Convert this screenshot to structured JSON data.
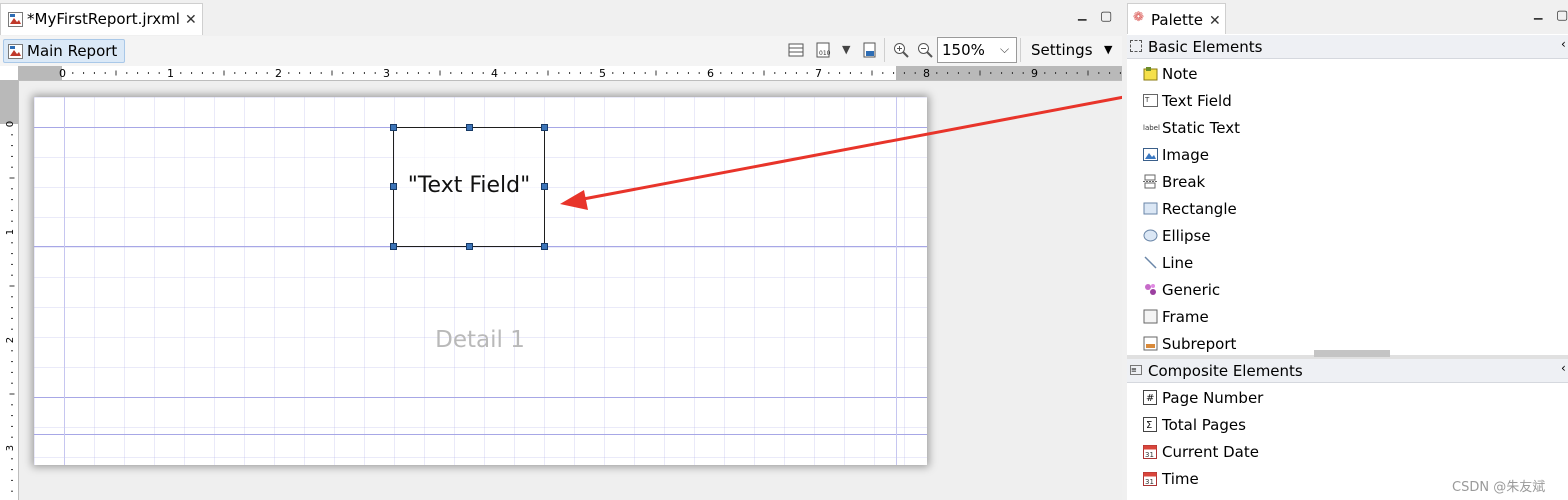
{
  "editor": {
    "tab_title": "*MyFirstReport.jrxml",
    "main_report_label": "Main Report",
    "zoom_value": "150%",
    "settings_label": "Settings",
    "ruler_numbers": [
      "0",
      "1",
      "2",
      "3",
      "4",
      "5",
      "6",
      "7",
      "8",
      "9"
    ],
    "vruler_numbers": [
      "0",
      "1",
      "2",
      "3"
    ],
    "text_field_text": "\"Text Field\"",
    "detail_band_label": "Detail 1"
  },
  "palette": {
    "tab_title": "Palette",
    "basic_header": "Basic Elements",
    "basic_items": [
      {
        "label": "Note",
        "icon": "note-icon"
      },
      {
        "label": "Text Field",
        "icon": "text-field-icon"
      },
      {
        "label": "Static Text",
        "icon": "static-text-icon",
        "icon_text": "label"
      },
      {
        "label": "Image",
        "icon": "image-icon"
      },
      {
        "label": "Break",
        "icon": "break-icon"
      },
      {
        "label": "Rectangle",
        "icon": "rectangle-icon"
      },
      {
        "label": "Ellipse",
        "icon": "ellipse-icon"
      },
      {
        "label": "Line",
        "icon": "line-icon"
      },
      {
        "label": "Generic",
        "icon": "generic-icon"
      },
      {
        "label": "Frame",
        "icon": "frame-icon"
      },
      {
        "label": "Subreport",
        "icon": "subreport-icon"
      }
    ],
    "composite_header": "Composite Elements",
    "composite_items": [
      {
        "label": "Page Number",
        "icon": "page-number-icon",
        "icon_text": "#"
      },
      {
        "label": "Total Pages",
        "icon": "total-pages-icon",
        "icon_text": "Σ"
      },
      {
        "label": "Current Date",
        "icon": "calendar-icon",
        "icon_text": "31"
      },
      {
        "label": "Time",
        "icon": "calendar-icon",
        "icon_text": "31"
      }
    ]
  },
  "watermark": "CSDN @朱友斌",
  "colors": {
    "accent_arrow": "#e8342a",
    "handle": "#3c74b8",
    "selection_bg": "#dbe9f7"
  }
}
